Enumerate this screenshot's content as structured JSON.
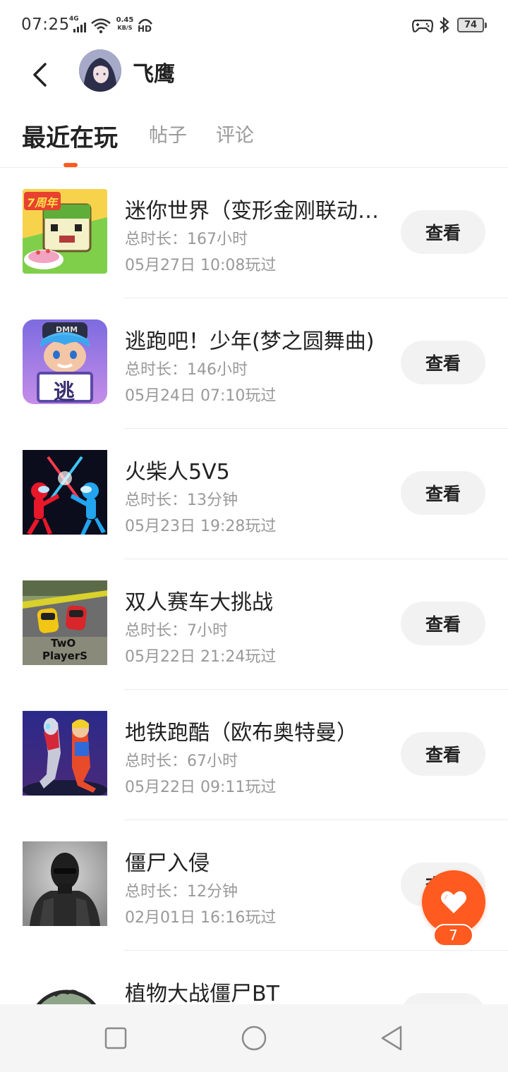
{
  "status_bar": {
    "time": "07:25",
    "network": "4G",
    "speed_value": "0.45",
    "speed_unit": "KB/S",
    "hd": "HD",
    "battery": "74"
  },
  "header": {
    "username": "飞鹰"
  },
  "tabs": [
    {
      "label": "最近在玩",
      "active": true
    },
    {
      "label": "帖子",
      "active": false
    },
    {
      "label": "评论",
      "active": false
    }
  ],
  "view_label": "查看",
  "games": [
    {
      "name": "迷你世界（变形金刚联动…",
      "duration": "总时长：167小时",
      "last_played": "05月27日 10:08玩过",
      "icon_badge": "7周年"
    },
    {
      "name": "逃跑吧！少年(梦之圆舞曲)",
      "duration": "总时长：146小时",
      "last_played": "05月24日 07:10玩过",
      "icon_badge": "逃",
      "icon_cap": "DMM"
    },
    {
      "name": "火柴人5V5",
      "duration": "总时长：13分钟",
      "last_played": "05月23日 19:28玩过"
    },
    {
      "name": "双人赛车大挑战",
      "duration": "总时长：7小时",
      "last_played": "05月22日 21:24玩过",
      "icon_text_1": "TwO",
      "icon_text_2": "PlayerS"
    },
    {
      "name": "地铁跑酷（欧布奥特曼）",
      "duration": "总时长：67小时",
      "last_played": "05月22日 09:11玩过"
    },
    {
      "name": "僵尸入侵",
      "duration": "总时长：12分钟",
      "last_played": "02月01日 16:16玩过"
    },
    {
      "name": "植物大战僵尸BT",
      "duration": "",
      "last_played": ""
    }
  ],
  "like": {
    "count": "7"
  },
  "colors": {
    "accent": "#ff5a1f",
    "button_bg": "#f2f2f2",
    "secondary_text": "#999999"
  }
}
